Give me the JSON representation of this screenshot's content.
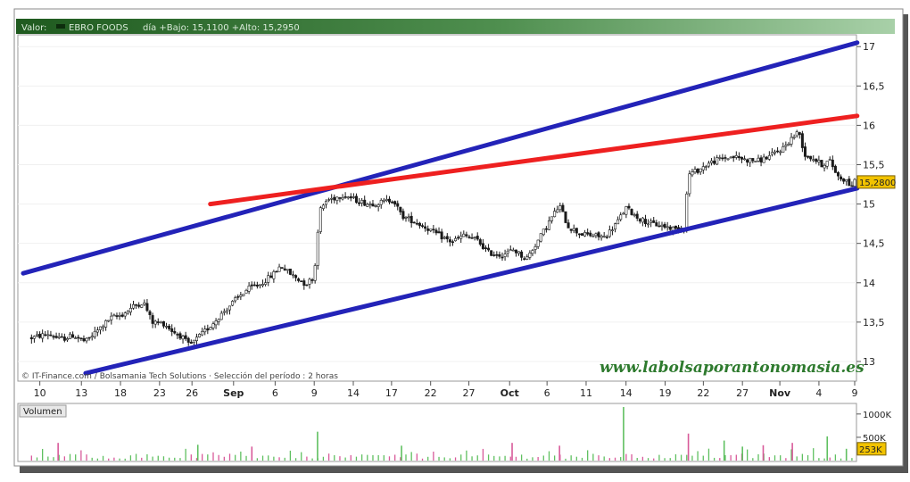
{
  "header": {
    "valor_label": "Valor:",
    "symbol": "EBRO FOODS",
    "info": "día +Bajo: 15,1100 +Alto: 15,2950"
  },
  "credits": "© IT-Finance.com / Bolsamania Tech Solutions · Selección del período : 2 horas",
  "watermark": "www.labolsaporantonomasia.es",
  "volume_panel": {
    "title": "Volumen"
  },
  "colors": {
    "header_dark": "#1f5a1f",
    "header_light": "#8ec08e",
    "candle": "#1a1a1a",
    "candle_light": "#b5b5b5",
    "trend_blue": "#2323b8",
    "trend_red": "#ee2020",
    "watermark": "#2e7a2e",
    "last_price_bg": "#f2c300",
    "volume_bar": "#5fc060",
    "volume_bar_alt": "#d85a9a"
  },
  "chart_data": {
    "type": "candlestick",
    "price_axis": {
      "ticks": [
        13,
        13.5,
        14,
        14.5,
        15,
        15.5,
        16,
        16.5,
        17
      ],
      "tick_labels": [
        "13",
        "13,5",
        "14",
        "14,5",
        "15",
        "15,5",
        "16",
        "16,5",
        "17"
      ],
      "ylim": [
        12.75,
        17.15
      ],
      "last_price": 15.28,
      "last_price_label": "15,2800"
    },
    "x_axis": {
      "xlim": [
        0,
        100
      ],
      "ticks": [
        {
          "label": "10",
          "x": 2,
          "major": false
        },
        {
          "label": "13",
          "x": 7,
          "major": false
        },
        {
          "label": "18",
          "x": 11.7,
          "major": false
        },
        {
          "label": "23",
          "x": 16.4,
          "major": false
        },
        {
          "label": "26",
          "x": 20.3,
          "major": false
        },
        {
          "label": "Sep",
          "x": 25.3,
          "major": true
        },
        {
          "label": "6",
          "x": 30.3,
          "major": false
        },
        {
          "label": "9",
          "x": 35,
          "major": false
        },
        {
          "label": "14",
          "x": 39.7,
          "major": false
        },
        {
          "label": "17",
          "x": 44.3,
          "major": false
        },
        {
          "label": "22",
          "x": 49,
          "major": false
        },
        {
          "label": "27",
          "x": 53.6,
          "major": false
        },
        {
          "label": "Oct",
          "x": 58.5,
          "major": true
        },
        {
          "label": "6",
          "x": 63,
          "major": false
        },
        {
          "label": "11",
          "x": 67.7,
          "major": false
        },
        {
          "label": "14",
          "x": 72.5,
          "major": false
        },
        {
          "label": "19",
          "x": 77.2,
          "major": false
        },
        {
          "label": "22",
          "x": 81.8,
          "major": false
        },
        {
          "label": "27",
          "x": 86.5,
          "major": false
        },
        {
          "label": "Nov",
          "x": 91,
          "major": true
        },
        {
          "label": "4",
          "x": 95.7,
          "major": false
        },
        {
          "label": "9",
          "x": 100,
          "major": false
        }
      ]
    },
    "price_path": [
      [
        1,
        13.3
      ],
      [
        3,
        13.35
      ],
      [
        4.5,
        13.28
      ],
      [
        6,
        13.33
      ],
      [
        7.5,
        13.25
      ],
      [
        9,
        13.4
      ],
      [
        10.5,
        13.55
      ],
      [
        12,
        13.6
      ],
      [
        13.5,
        13.72
      ],
      [
        14.5,
        13.75
      ],
      [
        15.5,
        13.5
      ],
      [
        17,
        13.48
      ],
      [
        18,
        13.38
      ],
      [
        19,
        13.32
      ],
      [
        20,
        13.2
      ],
      [
        21,
        13.3
      ],
      [
        22.5,
        13.45
      ],
      [
        24,
        13.62
      ],
      [
        25.5,
        13.78
      ],
      [
        27,
        13.92
      ],
      [
        28.5,
        13.98
      ],
      [
        30,
        14.1
      ],
      [
        31,
        14.22
      ],
      [
        32,
        14.12
      ],
      [
        33,
        14.05
      ],
      [
        34,
        13.98
      ],
      [
        35,
        14.08
      ],
      [
        35.6,
        14.9
      ],
      [
        36.5,
        15.05
      ],
      [
        37.5,
        15.08
      ],
      [
        38.5,
        15.12
      ],
      [
        40,
        15.05
      ],
      [
        41.5,
        15.0
      ],
      [
        43,
        15.02
      ],
      [
        44.5,
        15.06
      ],
      [
        45.5,
        14.85
      ],
      [
        47,
        14.78
      ],
      [
        48.5,
        14.7
      ],
      [
        50,
        14.6
      ],
      [
        51.5,
        14.52
      ],
      [
        53,
        14.6
      ],
      [
        54.5,
        14.55
      ],
      [
        56,
        14.38
      ],
      [
        57.5,
        14.35
      ],
      [
        59,
        14.42
      ],
      [
        60.5,
        14.3
      ],
      [
        62,
        14.55
      ],
      [
        63.5,
        14.82
      ],
      [
        64.5,
        14.98
      ],
      [
        65.5,
        14.72
      ],
      [
        67,
        14.62
      ],
      [
        68.5,
        14.6
      ],
      [
        70,
        14.58
      ],
      [
        71.5,
        14.78
      ],
      [
        72.5,
        14.95
      ],
      [
        74,
        14.82
      ],
      [
        75.5,
        14.75
      ],
      [
        77,
        14.72
      ],
      [
        78.5,
        14.68
      ],
      [
        79.5,
        14.72
      ],
      [
        80,
        15.38
      ],
      [
        81,
        15.42
      ],
      [
        82.5,
        15.52
      ],
      [
        84,
        15.58
      ],
      [
        85.5,
        15.6
      ],
      [
        87,
        15.56
      ],
      [
        88.5,
        15.55
      ],
      [
        90,
        15.62
      ],
      [
        91.5,
        15.72
      ],
      [
        92.5,
        15.85
      ],
      [
        93.3,
        15.92
      ],
      [
        94,
        15.62
      ],
      [
        95,
        15.58
      ],
      [
        96,
        15.5
      ],
      [
        97,
        15.55
      ],
      [
        98,
        15.35
      ],
      [
        99,
        15.3
      ],
      [
        99.5,
        15.22
      ],
      [
        100,
        15.28
      ]
    ],
    "volume_axis": {
      "ticks": [
        500,
        1000
      ],
      "tick_labels": [
        "500K",
        "1000K"
      ],
      "ylim": [
        0,
        1150
      ],
      "last_volume": 253,
      "last_volume_label": "253K"
    },
    "volume_spikes": [
      {
        "x": 35.4,
        "v": 620
      },
      {
        "x": 80.0,
        "v": 580
      },
      {
        "x": 72.2,
        "v": 1150
      },
      {
        "x": 58.8,
        "v": 380
      },
      {
        "x": 84.3,
        "v": 430
      },
      {
        "x": 64.5,
        "v": 320
      },
      {
        "x": 96.7,
        "v": 520
      },
      {
        "x": 92.5,
        "v": 380
      },
      {
        "x": 45.5,
        "v": 320
      },
      {
        "x": 4.2,
        "v": 380
      },
      {
        "x": 21.0,
        "v": 340
      },
      {
        "x": 27.5,
        "v": 300
      },
      {
        "x": 86.5,
        "v": 300
      },
      {
        "x": 89.0,
        "v": 330
      },
      {
        "x": 99.0,
        "v": 253
      }
    ],
    "trendlines": [
      {
        "color": "blue",
        "from": [
          0,
          14.12
        ],
        "to": [
          100.3,
          17.05
        ]
      },
      {
        "color": "blue",
        "from": [
          7.5,
          12.85
        ],
        "to": [
          100.3,
          15.2
        ]
      },
      {
        "color": "red",
        "from": [
          22.5,
          15.0
        ],
        "to": [
          100.3,
          16.12
        ]
      }
    ]
  }
}
